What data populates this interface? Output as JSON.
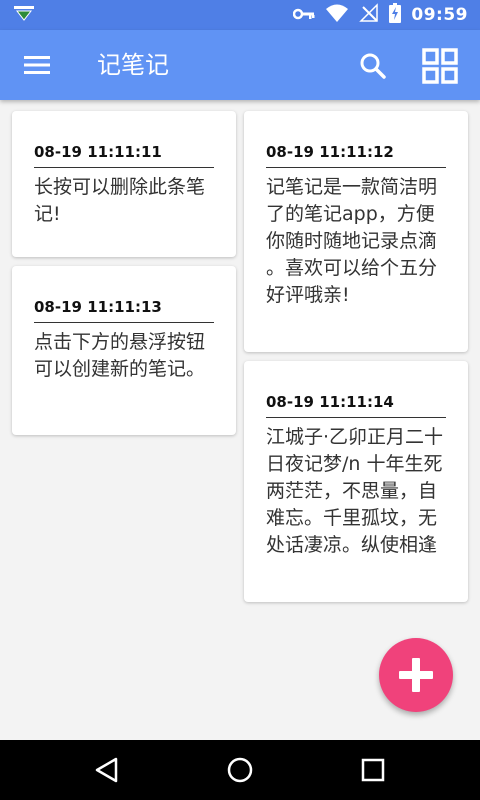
{
  "status_bar": {
    "time": "09:59"
  },
  "app_bar": {
    "title": "记笔记"
  },
  "notes": [
    {
      "date": "08-19 11:11:11",
      "content": "长按可以删除此条笔记!"
    },
    {
      "date": "08-19 11:11:12",
      "content": "记笔记是一款简洁明了的笔记app，方便你随时随地记录点滴 。喜欢可以给个五分好评哦亲!"
    },
    {
      "date": "08-19 11:11:13",
      "content": "点击下方的悬浮按钮可以创建新的笔记。"
    },
    {
      "date": "08-19 11:11:14",
      "content": "江城子·乙卯正月二十日夜记梦/n 十年生死两茫茫，不思量，自难忘。千里孤坟，无处话凄凉。纵使相逢应…"
    }
  ],
  "colors": {
    "status_bar": "#4f7fe6",
    "app_bar": "#6093f4",
    "fab": "#f0427b",
    "background": "#f3f3f3"
  },
  "icons": {
    "menu": "hamburger-menu-icon",
    "search": "search-icon",
    "grid": "grid-view-icon",
    "fab": "plus-icon",
    "nav_back": "back-triangle-icon",
    "nav_home": "home-circle-icon",
    "nav_recents": "recents-square-icon"
  }
}
